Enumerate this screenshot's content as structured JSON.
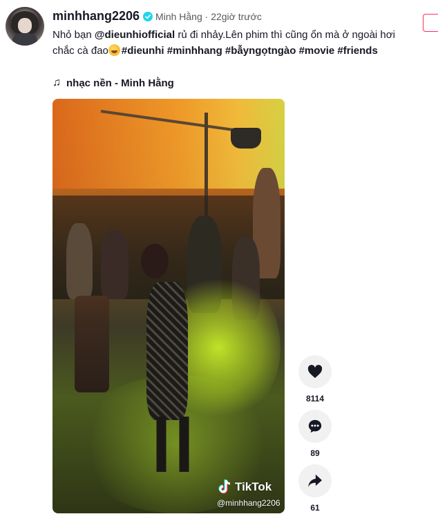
{
  "post": {
    "username": "minhhang2206",
    "nickname": "Minh Hằng · 22giờ trước",
    "caption": {
      "part1": "Nhỏ bạn ",
      "mention": "@dieunhiofficial",
      "part2": " rủ đi nhảy.Lên phim thì cũng ổn mà ở ngoài hơi chắc cà đao",
      "tags": "#dieunhi #minhhang #bẫyngọtngào #movie #friends"
    },
    "music": "nhạc nền - Minh Hằng"
  },
  "video": {
    "watermark_brand": "TikTok",
    "watermark_user": "@minhhang2206"
  },
  "actions": {
    "likes": "8114",
    "comments": "89",
    "shares": "61"
  },
  "colors": {
    "accent": "#fe2c55",
    "verified": "#20d5ec",
    "action_bg": "#f1f1f2"
  },
  "icons": [
    "verified-icon",
    "music-note-icon",
    "heart-icon",
    "comment-icon",
    "share-icon",
    "tiktok-logo-icon"
  ]
}
